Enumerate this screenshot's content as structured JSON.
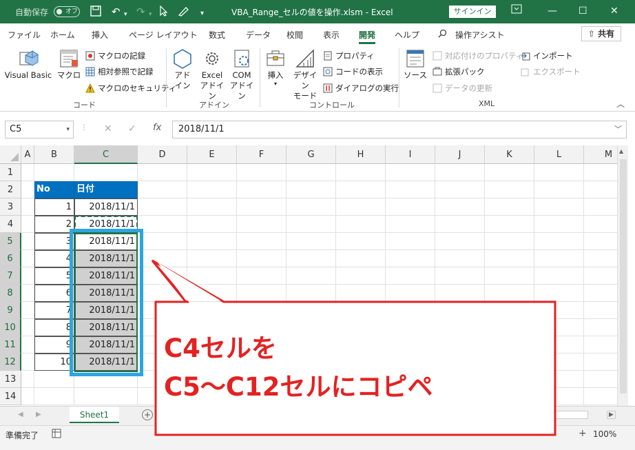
{
  "titlebar": {
    "autosave_label": "自動保存",
    "autosave_state": "オフ",
    "title": "VBA_Range_セルの値を操作.xlsm  -  Excel",
    "signin_label": "サインイン",
    "colors": {
      "bar": "#217346"
    }
  },
  "tabs": [
    {
      "label": "ファイル"
    },
    {
      "label": "ホーム"
    },
    {
      "label": "挿入"
    },
    {
      "label": "ページ レイアウト"
    },
    {
      "label": "数式"
    },
    {
      "label": "データ"
    },
    {
      "label": "校閲"
    },
    {
      "label": "表示"
    },
    {
      "label": "開発",
      "active": true
    },
    {
      "label": "ヘルプ"
    },
    {
      "label": "操作アシスト"
    }
  ],
  "share_label": "共有",
  "ribbon": {
    "code": {
      "visual_basic": "Visual Basic",
      "macro": "マクロ",
      "record_macro": "マクロの記録",
      "relative_ref": "相対参照で記録",
      "macro_security": "マクロのセキュリティ",
      "group": "コード"
    },
    "addins": {
      "addin": "アド\nイン",
      "excel_addin": "Excel\nアドイン",
      "com_addin": "COM\nアドイン",
      "group": "アドイン"
    },
    "controls": {
      "insert": "挿入",
      "design_mode": "デザイン\nモード",
      "properties": "プロパティ",
      "view_code": "コードの表示",
      "run_dialog": "ダイアログの実行",
      "group": "コントロール"
    },
    "xml": {
      "source": "ソース",
      "map_properties": "対応付けのプロパティ",
      "expansion_packs": "拡張パック",
      "refresh_data": "データの更新",
      "import": "インポート",
      "export": "エクスポート",
      "group": "XML"
    }
  },
  "formula_bar": {
    "name_box": "C5",
    "fx": "fx",
    "formula": "2018/11/1"
  },
  "columns": [
    "A",
    "B",
    "C",
    "D",
    "E",
    "F",
    "G",
    "H",
    "I",
    "J",
    "K",
    "L",
    "M"
  ],
  "rows": [
    "1",
    "2",
    "3",
    "4",
    "5",
    "6",
    "7",
    "8",
    "9",
    "10",
    "11",
    "12",
    "13",
    "14"
  ],
  "table": {
    "header_no": "No",
    "header_date": "日付",
    "numbers": [
      "1",
      "2",
      "3",
      "4",
      "5",
      "6",
      "7",
      "8",
      "9",
      "10"
    ],
    "dates": [
      "2018/11/1",
      "2018/11/1",
      "2018/11/1",
      "2018/11/1",
      "2018/11/1",
      "2018/11/1",
      "2018/11/1",
      "2018/11/1",
      "2018/11/1",
      "2018/11/1"
    ]
  },
  "sheet_tab": "Sheet1",
  "status": {
    "ready": "準備完了",
    "zoom": "100%"
  },
  "callout": {
    "line1": "C4セルを",
    "line2": "C5～C12セルにコピペ",
    "color": "#e32222"
  }
}
